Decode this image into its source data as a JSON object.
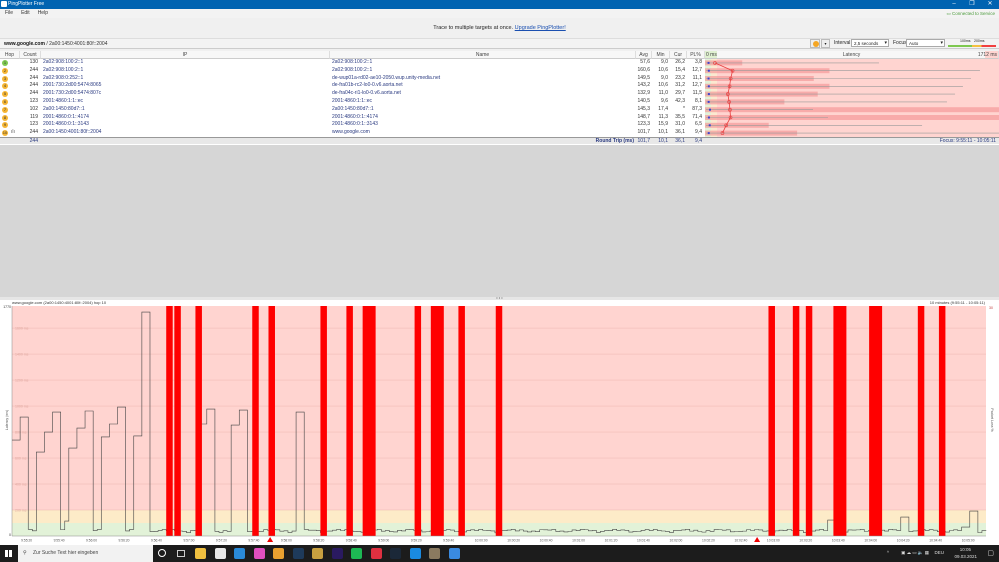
{
  "window": {
    "title": "PingPlotter Free",
    "status": "Connected to Service"
  },
  "menu": [
    "File",
    "Edit",
    "Help"
  ],
  "banner": {
    "text": "Trace to multiple targets at once.",
    "link": "Upgrade PingPlotter!"
  },
  "target": {
    "host": "www.google.com",
    "ip": " / 2a00:1450:4001:80f::2004"
  },
  "controls": {
    "interval_label": "Interval",
    "interval_value": "2,5 seconds",
    "focus_label": "Focus",
    "focus_value": "Auto",
    "scale_100": "100ms",
    "scale_200": "200ms",
    "pause_icon": "pause-icon"
  },
  "table": {
    "headers": {
      "hop": "Hop",
      "count": "Count",
      "ip": "IP",
      "name": "Name",
      "avg": "Avg",
      "min": "Min",
      "cur": "Cur",
      "pl": "PL%",
      "latency": "Latency",
      "lat_min": "0 ms",
      "lat_max": "1712 ms"
    },
    "latency_scale_max_ms": 1712,
    "pl_scale_max": 30,
    "rows": [
      {
        "hop": "1",
        "count": "130",
        "ip": "2a02:908:100:2::1",
        "name": "2a02:908:100:2::1",
        "avg": "57,6",
        "min": "9,0",
        "cur": "26,2",
        "pl": "3,8",
        "max_ms": 1013,
        "color": "#7ec850"
      },
      {
        "hop": "2",
        "count": "244",
        "ip": "2a02:908:100:2::1",
        "name": "2a02:908:100:2::1",
        "avg": "160,6",
        "min": "10,6",
        "cur": "15,4",
        "pl": "12,7",
        "max_ms": 1601,
        "color": "#f5b533"
      },
      {
        "hop": "3",
        "count": "244",
        "ip": "2a02:908:0:252::1",
        "name": "de-wup01a-rd02-ae10-2050.wup.unity-media.net",
        "avg": "149,5",
        "min": "9,0",
        "cur": "23,2",
        "pl": "11,1",
        "max_ms": 1549,
        "color": "#f5b533"
      },
      {
        "hop": "4",
        "count": "244",
        "ip": "2001:730:2d00:5474:8065",
        "name": "de-fra01b-rc2-lo0-0.v6.aorta.net",
        "avg": "143,2",
        "min": "10,6",
        "cur": "31,2",
        "pl": "12,7",
        "max_ms": 1502,
        "color": "#f5b533"
      },
      {
        "hop": "5",
        "count": "244",
        "ip": "2001:730:2d00:5474:807c",
        "name": "de-fra04c-ri1-lo0-0.v6.aorta.net",
        "avg": "132,9",
        "min": "11,0",
        "cur": "29,7",
        "pl": "11,5",
        "max_ms": 1456,
        "color": "#f5b533"
      },
      {
        "hop": "6",
        "count": "123",
        "ip": "2001:4860:1:1::ec",
        "name": "2001:4860:1:1::ec",
        "avg": "140,5",
        "min": "9,6",
        "cur": "42,3",
        "pl": "8,1",
        "max_ms": 1409,
        "color": "#f5b533"
      },
      {
        "hop": "7",
        "count": "102",
        "ip": "2a00:1450:80d7::1",
        "name": "2a00:1450:80d7::1",
        "avg": "145,3",
        "min": "17,4",
        "cur": "*",
        "pl": "87,3",
        "max_ms": 629,
        "color": "#f5b533"
      },
      {
        "hop": "8",
        "count": "119",
        "ip": "2001:4860:0:1::4174",
        "name": "2001:4860:0:1::4174",
        "avg": "148,7",
        "min": "11,3",
        "cur": "35,5",
        "pl": "71,4",
        "max_ms": 716,
        "color": "#f5b533"
      },
      {
        "hop": "9",
        "count": "123",
        "ip": "2001:4860:0:1::3143",
        "name": "2001:4860:0:1::3143",
        "avg": "123,3",
        "min": "15,9",
        "cur": "31,0",
        "pl": "6,5",
        "max_ms": 1264,
        "color": "#f5b533"
      },
      {
        "hop": "10",
        "count": "244",
        "ip": "2a00:1450:4001:80f::2004",
        "name": "www.google.com",
        "avg": "101,7",
        "min": "10,1",
        "cur": "36,1",
        "pl": "9,4",
        "max_ms": 1712,
        "color": "#f5b533",
        "icon": "graph-icon"
      }
    ],
    "summary": {
      "count": "244",
      "label": "Round Trip (ms)",
      "avg": "101,7",
      "min": "10,1",
      "cur": "36,1",
      "pl": "9,4",
      "focus": "Focus: 9:55:11 - 10:05:11"
    }
  },
  "graph": {
    "title": "www.google.com (2a00:1450:4001:80f::2004) hop 10",
    "range": "10 minutes (9:55:11 - 10:05:11)",
    "ylabel": "Latency (ms)",
    "y2label": "Packet Loss %",
    "ymax_label": "1770",
    "ymin_label": "0",
    "y2max_label": "30",
    "ymax": 1770,
    "gridlines": [
      {
        "v": 200,
        "label": "200 ms"
      },
      {
        "v": 400,
        "label": "400 ms"
      },
      {
        "v": 600,
        "label": "600 ms"
      },
      {
        "v": 800,
        "label": "800 ms"
      },
      {
        "v": 1000,
        "label": "1000 ms"
      },
      {
        "v": 1200,
        "label": "1200 ms"
      },
      {
        "v": 1400,
        "label": "1400 ms"
      },
      {
        "v": 1600,
        "label": "1600 ms"
      }
    ],
    "start": "9:55:11",
    "end": "10:05:11",
    "interval_s": 2.5,
    "zones": {
      "green_max": 100,
      "yellow_max": 200,
      "colors": {
        "green": "#e2f2d8",
        "yellow": "#fdebc8",
        "red": "#ffd4d0"
      }
    },
    "ticks": [
      "9:55:20",
      "9:55:40",
      "9:56:00",
      "9:56:20",
      "9:56:40",
      "9:57:00",
      "9:57:20",
      "9:57:40",
      "9:58:00",
      "9:58:20",
      "9:58:40",
      "9:59:00",
      "9:59:20",
      "9:59:40",
      "10:00:00",
      "10:00:20",
      "10:00:40",
      "10:01:00",
      "10:01:20",
      "10:01:40",
      "10:02:00",
      "10:02:20",
      "10:02:40",
      "10:03:00",
      "10:03:20",
      "10:03:40",
      "10:04:00",
      "10:04:20",
      "10:04:40",
      "10:05:00"
    ],
    "spikes": [
      {
        "t": "9:55:11",
        "ms": 738
      },
      {
        "t": "9:55:16",
        "ms": 915
      },
      {
        "t": "9:55:26",
        "ms": 646
      },
      {
        "t": "9:55:31",
        "ms": 800
      },
      {
        "t": "9:55:36",
        "ms": 954
      },
      {
        "t": "9:55:44",
        "ms": 115
      },
      {
        "t": "9:55:46",
        "ms": 677
      },
      {
        "t": "9:55:52",
        "ms": 831
      },
      {
        "t": "9:55:56",
        "ms": 962
      },
      {
        "t": "9:56:06",
        "ms": 762
      },
      {
        "t": "9:56:11",
        "ms": 862
      },
      {
        "t": "9:56:17",
        "ms": 992
      },
      {
        "t": "9:56:26",
        "ms": 770
      },
      {
        "t": "9:56:32",
        "ms": 1723
      },
      {
        "t": "9:57:06",
        "ms": 862
      },
      {
        "t": "9:57:11",
        "ms": 977
      },
      {
        "t": "9:57:27",
        "ms": 854
      },
      {
        "t": "9:57:31",
        "ms": 969
      },
      {
        "t": "9:58:06",
        "ms": 954
      },
      {
        "t": "10:03:34",
        "ms": 123
      },
      {
        "t": "10:04:19",
        "ms": 146
      },
      {
        "t": "10:04:55",
        "ms": 69
      },
      {
        "t": "10:05:00",
        "ms": 192
      }
    ],
    "losses": [
      {
        "t": "9:56:46",
        "n": 1
      },
      {
        "t": "9:56:51",
        "n": 1
      },
      {
        "t": "9:57:04",
        "n": 1
      },
      {
        "t": "9:57:39",
        "n": 1
      },
      {
        "t": "9:57:49",
        "n": 1
      },
      {
        "t": "9:58:21",
        "n": 1
      },
      {
        "t": "9:58:37",
        "n": 1
      },
      {
        "t": "9:58:47",
        "n": 2
      },
      {
        "t": "9:59:19",
        "n": 1
      },
      {
        "t": "9:59:29",
        "n": 2
      },
      {
        "t": "9:59:46",
        "n": 1
      },
      {
        "t": "10:00:09",
        "n": 1
      },
      {
        "t": "10:02:57",
        "n": 1
      },
      {
        "t": "10:03:12",
        "n": 1
      },
      {
        "t": "10:03:20",
        "n": 1
      },
      {
        "t": "10:03:37",
        "n": 2
      },
      {
        "t": "10:03:59",
        "n": 2
      },
      {
        "t": "10:04:29",
        "n": 1
      },
      {
        "t": "10:04:42",
        "n": 1
      }
    ],
    "markers": [
      "9:57:50",
      "10:02:50"
    ],
    "loss_color": "#ff0000"
  },
  "taskbar": {
    "search_placeholder": "Zur Suche Text hier eingeben",
    "apps": [
      {
        "name": "file-explorer-icon",
        "color": "#f0c040"
      },
      {
        "name": "store-icon",
        "color": "#e8e8e8"
      },
      {
        "name": "mail-icon",
        "color": "#2a8ad8"
      },
      {
        "name": "photos-icon",
        "color": "#e050c0"
      },
      {
        "name": "chrome-icon",
        "color": "#e8a030"
      },
      {
        "name": "lightroom-icon",
        "color": "#1e3a5a"
      },
      {
        "name": "app-icon",
        "color": "#c8a040"
      },
      {
        "name": "premiere-icon",
        "color": "#2a1a60"
      },
      {
        "name": "spotify-icon",
        "color": "#1db954"
      },
      {
        "name": "bolt-icon",
        "color": "#e03040"
      },
      {
        "name": "steam-icon",
        "color": "#1b2838"
      },
      {
        "name": "teamviewer-icon",
        "color": "#1a8ae0"
      },
      {
        "name": "settings-app-icon",
        "color": "#8a7a60"
      },
      {
        "name": "pingplotter-icon",
        "color": "#3a8ae0"
      }
    ],
    "language": "DEU",
    "time": "10:05",
    "date": "09.03.2021"
  }
}
